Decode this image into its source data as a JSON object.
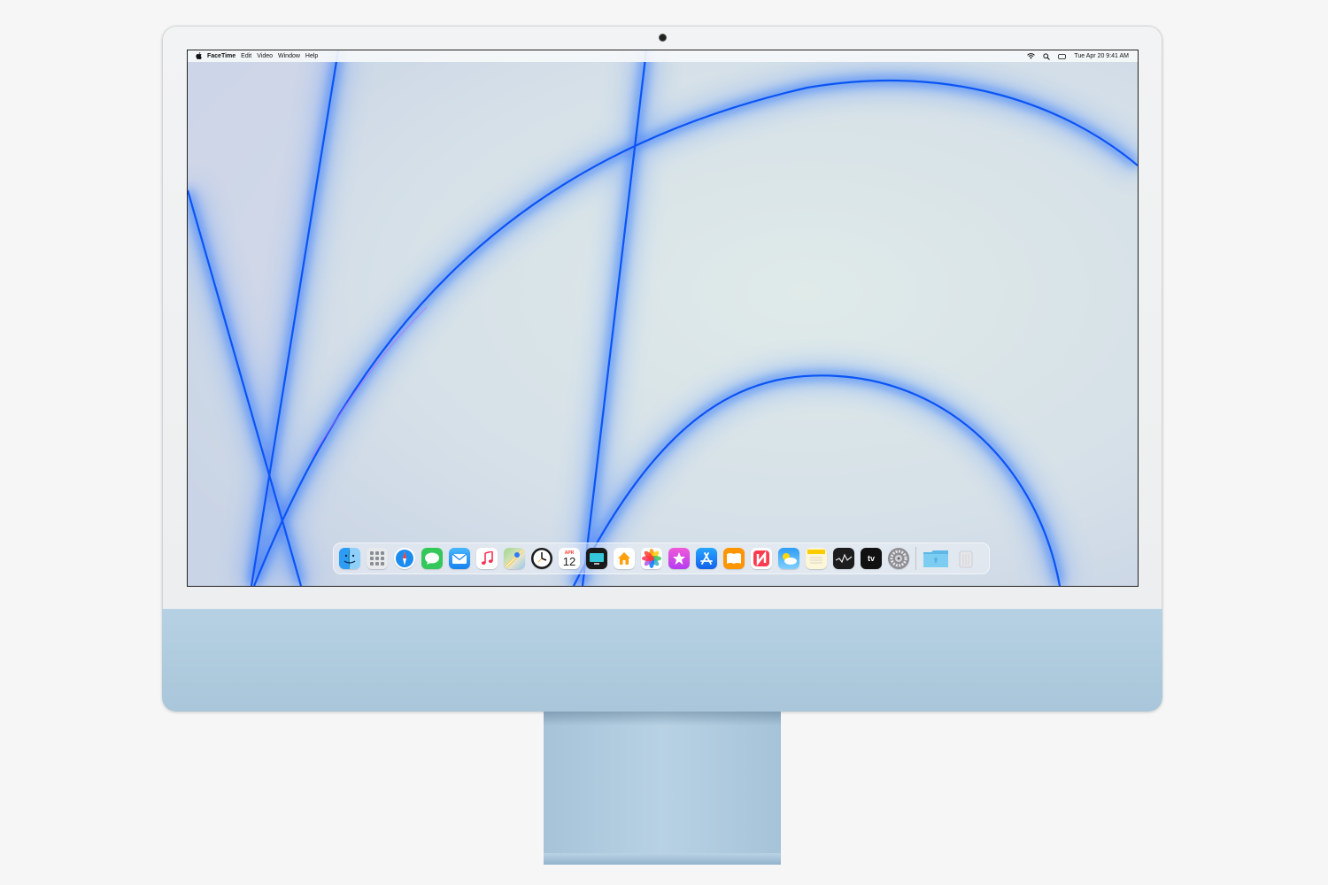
{
  "menubar": {
    "apple": "apple-logo-icon",
    "app_name": "FaceTime",
    "menus": [
      "Edit",
      "Video",
      "Window",
      "Help"
    ],
    "status_icons": [
      "wifi-icon",
      "spotlight-search-icon",
      "control-center-icon"
    ],
    "clock": "Tue Apr 20 9:41 AM"
  },
  "dock": {
    "apps": [
      {
        "name": "Finder",
        "icon": "finder-icon",
        "color": "#1e88e5"
      },
      {
        "name": "Launchpad",
        "icon": "launchpad-icon",
        "color": "#e8eaec"
      },
      {
        "name": "Safari",
        "icon": "safari-icon",
        "color": "#1a8cf0"
      },
      {
        "name": "Messages",
        "icon": "messages-icon",
        "color": "#34c759"
      },
      {
        "name": "Mail",
        "icon": "mail-icon",
        "color": "#2a9df4"
      },
      {
        "name": "Music",
        "icon": "music-icon",
        "color": "#ffffff"
      },
      {
        "name": "Maps",
        "icon": "maps-icon",
        "color": "#7cc576"
      },
      {
        "name": "Clock",
        "icon": "clock-icon",
        "color": "#1c1c1e"
      },
      {
        "name": "Calendar",
        "icon": "calendar-icon",
        "color": "#ffffff",
        "month": "APR",
        "day": "12"
      },
      {
        "name": "TV Screen",
        "icon": "screen-icon",
        "color": "#1a1a1a"
      },
      {
        "name": "Home",
        "icon": "home-icon",
        "color": "#ffffff"
      },
      {
        "name": "Photos",
        "icon": "photos-icon",
        "color": "#ffffff"
      },
      {
        "name": "iTunes Store",
        "icon": "star-icon",
        "color": "#e040c8"
      },
      {
        "name": "App Store",
        "icon": "app-store-icon",
        "color": "#1e7ff0"
      },
      {
        "name": "Books",
        "icon": "books-icon",
        "color": "#ff9500"
      },
      {
        "name": "News",
        "icon": "news-icon",
        "color": "#ff3b4f"
      },
      {
        "name": "Weather",
        "icon": "weather-icon",
        "color": "#4fb3f6"
      },
      {
        "name": "Notes",
        "icon": "notes-icon",
        "color": "#fdf6d8"
      },
      {
        "name": "Stocks",
        "icon": "stocks-icon",
        "color": "#1c1c1e"
      },
      {
        "name": "Apple TV",
        "icon": "apple-tv-icon",
        "color": "#111111",
        "label": "tv"
      },
      {
        "name": "System Preferences",
        "icon": "system-preferences-icon",
        "color": "#8e8e93"
      }
    ],
    "folders": [
      {
        "name": "Applications",
        "icon": "folder-icon",
        "color": "#6cc2ea"
      },
      {
        "name": "Trash",
        "icon": "trash-icon",
        "color": "#e5e5ea"
      }
    ]
  },
  "colors": {
    "chin": "#b0cce0",
    "bezel": "#f0f1f2",
    "wallpaper_base": "#d6e2ea",
    "wallpaper_accent": "#0a5cff"
  }
}
